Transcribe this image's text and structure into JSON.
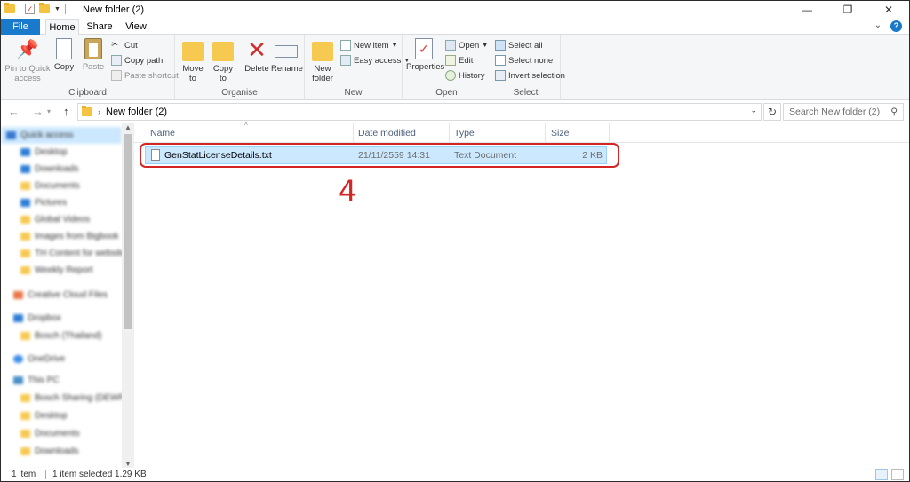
{
  "window": {
    "title": "New folder (2)",
    "minimize": "—",
    "maximize": "❐",
    "close": "✕"
  },
  "tabs": {
    "file": "File",
    "home": "Home",
    "share": "Share",
    "view": "View"
  },
  "help": {
    "expand_glyph": "⌄",
    "help_glyph": "?"
  },
  "ribbon": {
    "clipboard": {
      "label": "Clipboard",
      "pin": "Pin to Quick access",
      "copy": "Copy",
      "paste": "Paste",
      "cut": "Cut",
      "copy_path": "Copy path",
      "paste_shortcut": "Paste shortcut"
    },
    "organise": {
      "label": "Organise",
      "move_to": "Move to",
      "copy_to": "Copy to",
      "delete": "Delete",
      "rename": "Rename"
    },
    "new": {
      "label": "New",
      "new_folder": "New folder",
      "new_item": "New item",
      "easy_access": "Easy access"
    },
    "open": {
      "label": "Open",
      "properties": "Properties",
      "open": "Open",
      "edit": "Edit",
      "history": "History"
    },
    "select": {
      "label": "Select",
      "select_all": "Select all",
      "select_none": "Select none",
      "invert": "Invert selection"
    }
  },
  "address": {
    "path": "New folder (2)",
    "search_placeholder": "Search New folder (2)"
  },
  "nav_pane": {
    "items": [
      "Quick access",
      "Desktop",
      "Downloads",
      "Documents",
      "Pictures",
      "Global Videos",
      "Images from Bigbook",
      "TH Content for website",
      "Weekly Report",
      "Creative Cloud Files",
      "Dropbox",
      "Bosch (Thailand)",
      "OneDrive",
      "This PC",
      "Bosch Sharing (DEWP)",
      "Desktop",
      "Documents",
      "Downloads"
    ]
  },
  "file_list": {
    "columns": {
      "name": "Name",
      "date": "Date modified",
      "type": "Type",
      "size": "Size"
    },
    "rows": [
      {
        "name": "GenStatLicenseDetails.txt",
        "date": "21/11/2559 14:31",
        "type": "Text Document",
        "size": "2 KB"
      }
    ]
  },
  "annotation": {
    "step": "4",
    "color": "#d42525"
  },
  "status": {
    "count": "1 item",
    "selected": "1 item selected  1.29 KB"
  },
  "colors": {
    "accent": "#1979ca",
    "selection": "#cce8ff"
  }
}
